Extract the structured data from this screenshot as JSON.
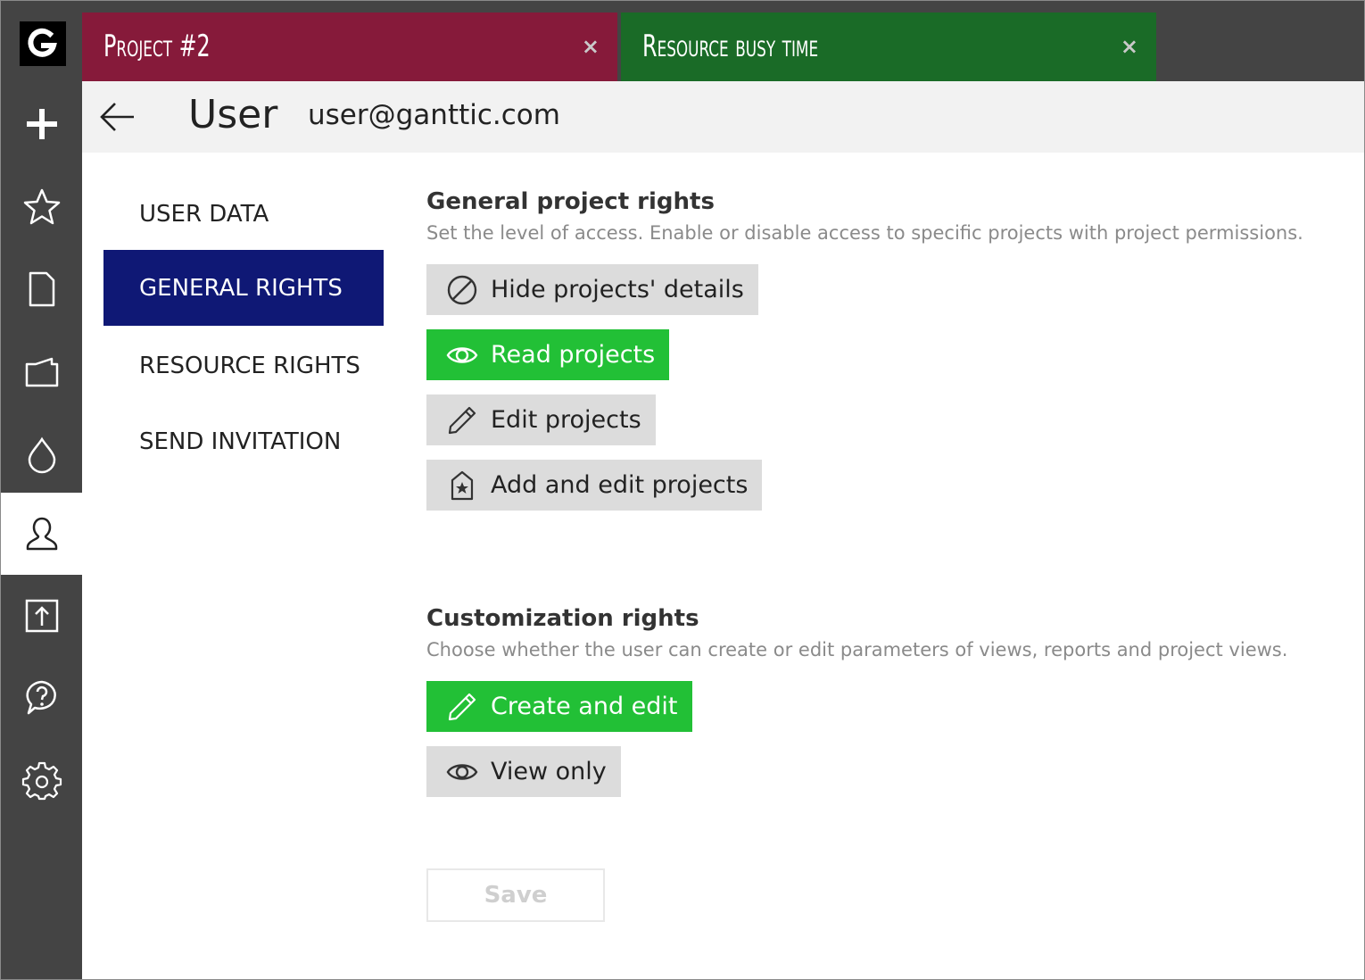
{
  "tabs": [
    {
      "title": "Project #2",
      "close": "×",
      "color": "#861a3a"
    },
    {
      "title": "Resource busy time",
      "close": "×",
      "color": "#1a6b27"
    }
  ],
  "sidebar": {
    "logo": "G",
    "items": [
      {
        "icon": "plus-icon"
      },
      {
        "icon": "star-icon"
      },
      {
        "icon": "document-icon"
      },
      {
        "icon": "folder-icon"
      },
      {
        "icon": "drop-icon"
      },
      {
        "icon": "user-icon",
        "active": true
      },
      {
        "icon": "upload-icon"
      },
      {
        "icon": "help-icon"
      },
      {
        "icon": "gear-icon"
      }
    ]
  },
  "header": {
    "title": "User",
    "email": "user@ganttic.com"
  },
  "nav": {
    "items": [
      {
        "label": "USER DATA"
      },
      {
        "label": "GENERAL RIGHTS",
        "active": true
      },
      {
        "label": "RESOURCE RIGHTS"
      },
      {
        "label": "SEND INVITATION"
      }
    ]
  },
  "general": {
    "title": "General project rights",
    "desc": "Set the level of access. Enable or disable access to specific projects with project permissions.",
    "options": [
      {
        "label": "Hide projects' details",
        "icon": "forbidden-icon",
        "selected": false
      },
      {
        "label": "Read projects",
        "icon": "eye-icon",
        "selected": true
      },
      {
        "label": "Edit projects",
        "icon": "pencil-icon",
        "selected": false
      },
      {
        "label": "Add and edit projects",
        "icon": "bookmark-star-icon",
        "selected": false
      }
    ]
  },
  "customization": {
    "title": "Customization rights",
    "desc": "Choose whether the user can create or edit parameters of views, reports and project views.",
    "options": [
      {
        "label": "Create and edit",
        "icon": "pencil-icon",
        "selected": true
      },
      {
        "label": "View only",
        "icon": "eye-icon",
        "selected": false
      }
    ]
  },
  "save_label": "Save",
  "colors": {
    "sidebar_bg": "#444444",
    "active_nav": "#0f1875",
    "selected_option": "#22c036",
    "option_bg": "#dcdcdc"
  }
}
